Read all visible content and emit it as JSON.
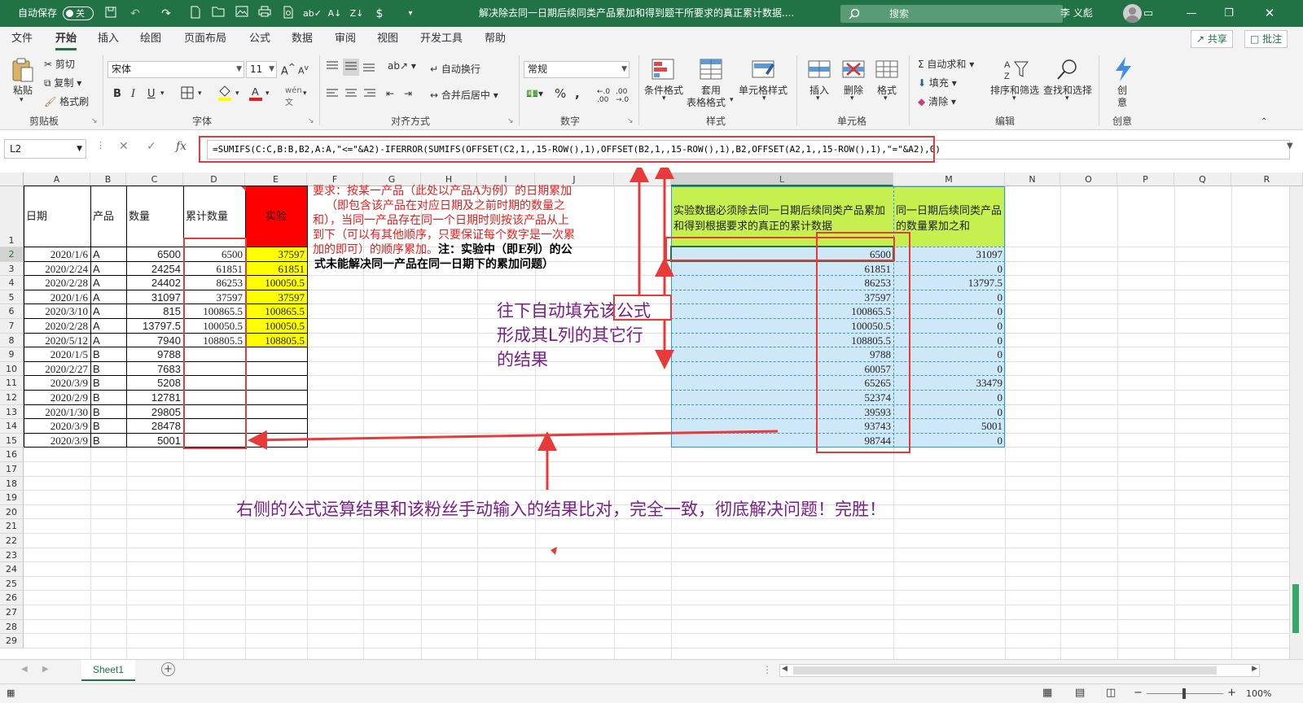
{
  "titlebar": {
    "autosave_label": "自动保存",
    "autosave_state": "关",
    "document_title": "解决除去同一日期后续同类产品累加和得到题干所要求的真正累计数据....",
    "search_placeholder": "搜索",
    "user_name": "李 义彪"
  },
  "menu": {
    "tabs": [
      "文件",
      "开始",
      "插入",
      "绘图",
      "页面布局",
      "公式",
      "数据",
      "审阅",
      "视图",
      "开发工具",
      "帮助"
    ],
    "active_tab": "开始",
    "share_label": "共享",
    "comment_label": "批注"
  },
  "ribbon": {
    "clipboard": {
      "paste": "粘贴",
      "cut": "剪切",
      "copy": "复制",
      "format_painter": "格式刷",
      "label": "剪贴板"
    },
    "font": {
      "name": "宋体",
      "size": "11",
      "bold": "B",
      "italic": "I",
      "underline": "U",
      "label": "字体",
      "font_color": "#e02020",
      "fill_color": "#ffff00"
    },
    "alignment": {
      "wrap": "自动换行",
      "merge": "合并后居中",
      "label": "对齐方式"
    },
    "number": {
      "format": "常规",
      "percent": "%",
      "label": "数字"
    },
    "styles": {
      "conditional": "条件格式",
      "table_line1": "套用",
      "table_line2": "表格格式",
      "cell_styles": "单元格样式",
      "label": "样式"
    },
    "cells": {
      "insert": "插入",
      "delete": "删除",
      "format": "格式",
      "label": "单元格"
    },
    "editing": {
      "autosum": "自动求和",
      "fill": "填充",
      "clear": "清除",
      "sort": "排序和筛选",
      "find": "查找和选择",
      "label": "编辑"
    },
    "ideas": {
      "line1": "创",
      "line2": "意",
      "label": "创意"
    }
  },
  "formula_bar": {
    "name_box": "L2",
    "fx": "fx",
    "formula": "=SUMIFS(C:C,B:B,B2,A:A,\"<=\"&A2)-IFERROR(SUMIFS(OFFSET(C2,1,,15-ROW(),1),OFFSET(B2,1,,15-ROW(),1),B2,OFFSET(A2,1,,15-ROW(),1),\"=\"&A2),0)"
  },
  "sheet": {
    "columns": [
      "A",
      "B",
      "C",
      "D",
      "E",
      "F",
      "G",
      "H",
      "I",
      "J",
      "K",
      "L",
      "M",
      "N",
      "O",
      "P",
      "Q",
      "R"
    ],
    "rows": [
      "1",
      "2",
      "3",
      "4",
      "5",
      "6",
      "7",
      "8",
      "9",
      "10",
      "11",
      "12",
      "13",
      "14",
      "15",
      "16",
      "17",
      "18",
      "19",
      "20",
      "21",
      "22",
      "23",
      "24",
      "25",
      "26",
      "27",
      "28",
      "29"
    ],
    "headers": {
      "A": "日期",
      "B": "产品",
      "C": "数量",
      "D": "累计数量",
      "E": "实验",
      "L": "实验数据必须除去同一日期后续同类产品累加和得到根据要求的真正的累计数据",
      "M": "同一日期后续同类产品的数量累加之和"
    },
    "data_rows": [
      {
        "a": "2020/1/6",
        "b": "A",
        "c": "6500",
        "d": "6500",
        "e": "37597",
        "l": "6500",
        "m": "31097"
      },
      {
        "a": "2020/2/24",
        "b": "A",
        "c": "24254",
        "d": "61851",
        "e": "61851",
        "l": "61851",
        "m": "0"
      },
      {
        "a": "2020/2/28",
        "b": "A",
        "c": "24402",
        "d": "86253",
        "e": "100050.5",
        "l": "86253",
        "m": "13797.5"
      },
      {
        "a": "2020/1/6",
        "b": "A",
        "c": "31097",
        "d": "37597",
        "e": "37597",
        "l": "37597",
        "m": "0"
      },
      {
        "a": "2020/3/10",
        "b": "A",
        "c": "815",
        "d": "100865.5",
        "e": "100865.5",
        "l": "100865.5",
        "m": "0"
      },
      {
        "a": "2020/2/28",
        "b": "A",
        "c": "13797.5",
        "d": "100050.5",
        "e": "100050.5",
        "l": "100050.5",
        "m": "0"
      },
      {
        "a": "2020/5/12",
        "b": "A",
        "c": "7940",
        "d": "108805.5",
        "e": "108805.5",
        "l": "108805.5",
        "m": "0"
      },
      {
        "a": "2020/1/5",
        "b": "B",
        "c": "9788",
        "d": "",
        "e": "",
        "l": "9788",
        "m": "0"
      },
      {
        "a": "2020/2/27",
        "b": "B",
        "c": "7683",
        "d": "",
        "e": "",
        "l": "60057",
        "m": "0"
      },
      {
        "a": "2020/3/9",
        "b": "B",
        "c": "5208",
        "d": "",
        "e": "",
        "l": "65265",
        "m": "33479"
      },
      {
        "a": "2020/2/9",
        "b": "B",
        "c": "12781",
        "d": "",
        "e": "",
        "l": "52374",
        "m": "0"
      },
      {
        "a": "2020/1/30",
        "b": "B",
        "c": "29805",
        "d": "",
        "e": "",
        "l": "39593",
        "m": "0"
      },
      {
        "a": "2020/3/9",
        "b": "B",
        "c": "28478",
        "d": "",
        "e": "",
        "l": "93743",
        "m": "5001"
      },
      {
        "a": "2020/3/9",
        "b": "B",
        "c": "5001",
        "d": "",
        "e": "",
        "l": "98744",
        "m": "0"
      }
    ]
  },
  "annotations": {
    "requirement_line1": "要求：按某一产品（此处以产品A为例）的日期累加",
    "requirement_line2": "（即包含该产品在对应日期及之前时期的数量之",
    "requirement_line3": "和），当同一产品存在同一个日期时则按该产品从上",
    "requirement_line4": "到下（可以有其他顺序，只要保证每个数字是一次累",
    "requirement_line5": "加的即可）的顺序累加。",
    "requirement_note_line1": "注：实验中（即E列）的公",
    "requirement_note_line2": "式未能解决同一产品在同一日期下的累加问题）",
    "autofill_line1": "往下自动填充该公式",
    "autofill_line2": "形成其L列的其它行",
    "autofill_line3": "的结果",
    "conclusion": "右侧的公式运算结果和该粉丝手动输入的结果比对，完全一致，彻底解决问题！完胜！"
  },
  "bottom": {
    "sheet_tab": "Sheet1",
    "zoom": "100%"
  },
  "colors": {
    "excel_green": "#217346",
    "header_red": "#ff0000",
    "exp_yellow": "#ffff00",
    "header_green": "#c6ef50",
    "result_blue": "#cfe8f7",
    "annotation_red": "#e83a3a",
    "annotation_purple": "#7a1f8a"
  }
}
